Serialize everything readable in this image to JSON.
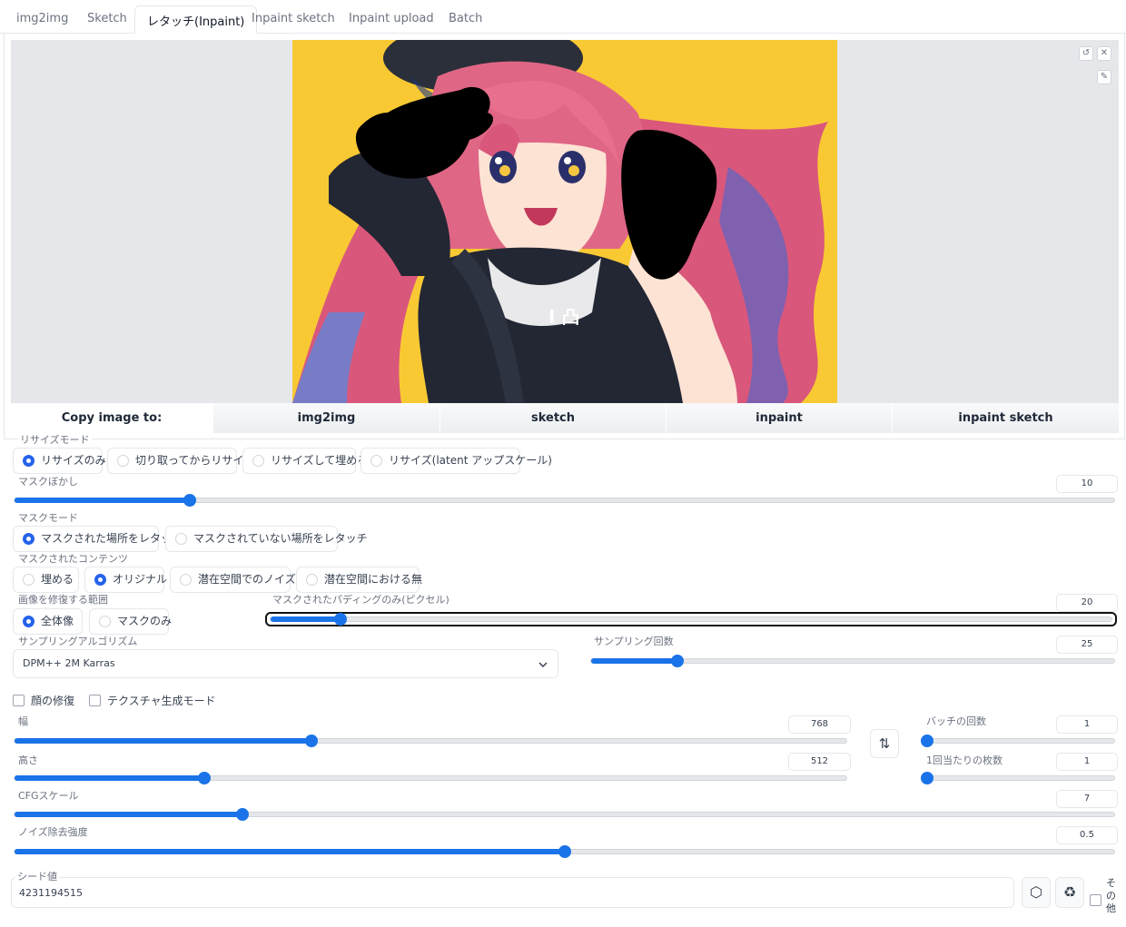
{
  "tabs": [
    "img2img",
    "Sketch",
    "レタッチ(Inpaint)",
    "Inpaint sketch",
    "Inpaint upload",
    "Batch"
  ],
  "active_tab": "レタッチ(Inpaint)",
  "image_toolbar": {
    "undo_icon": "undo-icon",
    "clear_icon": "close-icon",
    "brush_icon": "brush-icon",
    "undo_glyph": "↺",
    "clear_glyph": "✕",
    "brush_glyph": "✎"
  },
  "artwork": {
    "background_color": "#f9c934",
    "hoodie_logo": "I 凸",
    "mask_color": "#000000"
  },
  "copy_bar": {
    "label": "Copy image to:",
    "buttons": [
      "img2img",
      "sketch",
      "inpaint",
      "inpaint sketch"
    ]
  },
  "resize_mode": {
    "label": "リサイズモード",
    "options": [
      "リサイズのみ",
      "切り取ってからリサイズ",
      "リサイズして埋める",
      "リサイズ(latent アップスケール)"
    ],
    "selected": "リサイズのみ"
  },
  "mask_blur": {
    "label": "マスクぼかし",
    "value": "10",
    "fraction": 0.159
  },
  "mask_mode": {
    "label": "マスクモード",
    "options": [
      "マスクされた場所をレタッチ",
      "マスクされていない場所をレタッチ"
    ],
    "selected": "マスクされた場所をレタッチ"
  },
  "masked_content": {
    "label": "マスクされたコンテンツ",
    "options": [
      "埋める",
      "オリジナル",
      "潜在空間でのノイズ",
      "潜在空間における無"
    ],
    "selected": "オリジナル"
  },
  "inpaint_area": {
    "label": "画像を修復する範囲",
    "options": [
      "全体像",
      "マスクのみ"
    ],
    "selected": "全体像"
  },
  "padding": {
    "label": "マスクされたパディングのみ(ピクセル)",
    "value": "20",
    "fraction": 0.083
  },
  "sampler": {
    "label": "サンプリングアルゴリズム",
    "value": "DPM++ 2M Karras"
  },
  "sampling_steps": {
    "label": "サンプリング回数",
    "value": "25",
    "fraction": 0.165
  },
  "checkboxes": {
    "restore_faces": "顔の修復",
    "tiling": "テクスチャ生成モード"
  },
  "width": {
    "label": "幅",
    "value": "768",
    "fraction": 0.357
  },
  "height": {
    "label": "高さ",
    "value": "512",
    "fraction": 0.228
  },
  "swap_glyph": "⇅",
  "batch_count": {
    "label": "バッチの回数",
    "value": "1",
    "fraction": 0.0
  },
  "batch_size": {
    "label": "1回当たりの枚数",
    "value": "1",
    "fraction": 0.0
  },
  "cfg_scale": {
    "label": "CFGスケール",
    "value": "7",
    "fraction": 0.207
  },
  "denoising": {
    "label": "ノイズ除去強度",
    "value": "0.5",
    "fraction": 0.5
  },
  "seed": {
    "label": "シード値",
    "value": "4231194515",
    "dice_icon": "dice-icon",
    "recycle_icon": "recycle-icon",
    "dice_glyph": "⬡",
    "recycle_glyph": "♻"
  },
  "extra": {
    "label": "その他"
  }
}
